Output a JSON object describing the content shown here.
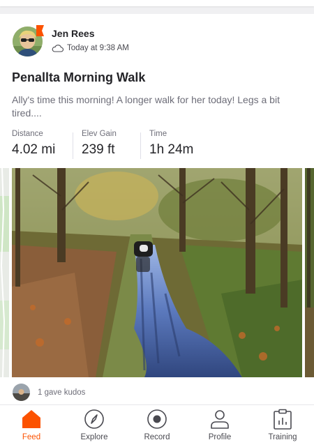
{
  "colors": {
    "brand": "#fc5200",
    "text_primary": "#242428",
    "text_secondary": "#6d6d78"
  },
  "activity": {
    "athlete_name": "Jen Rees",
    "activity_type_icon": "cloud-icon",
    "timestamp": "Today at 9:38 AM",
    "title": "Penallta Morning Walk",
    "description": "Ally's time this morning! A longer walk for her today! Legs a bit tired....",
    "stats": [
      {
        "label": "Distance",
        "value": "4.02 mi"
      },
      {
        "label": "Elev Gain",
        "value": "239 ft"
      },
      {
        "label": "Time",
        "value": "1h 24m"
      }
    ],
    "kudos_text": "1 gave kudos"
  },
  "tabbar": {
    "items": [
      {
        "label": "Feed",
        "icon": "home-icon",
        "active": true
      },
      {
        "label": "Explore",
        "icon": "compass-icon",
        "active": false
      },
      {
        "label": "Record",
        "icon": "record-icon",
        "active": false
      },
      {
        "label": "Profile",
        "icon": "person-icon",
        "active": false
      },
      {
        "label": "Training",
        "icon": "clipboard-chart-icon",
        "active": false
      }
    ]
  }
}
